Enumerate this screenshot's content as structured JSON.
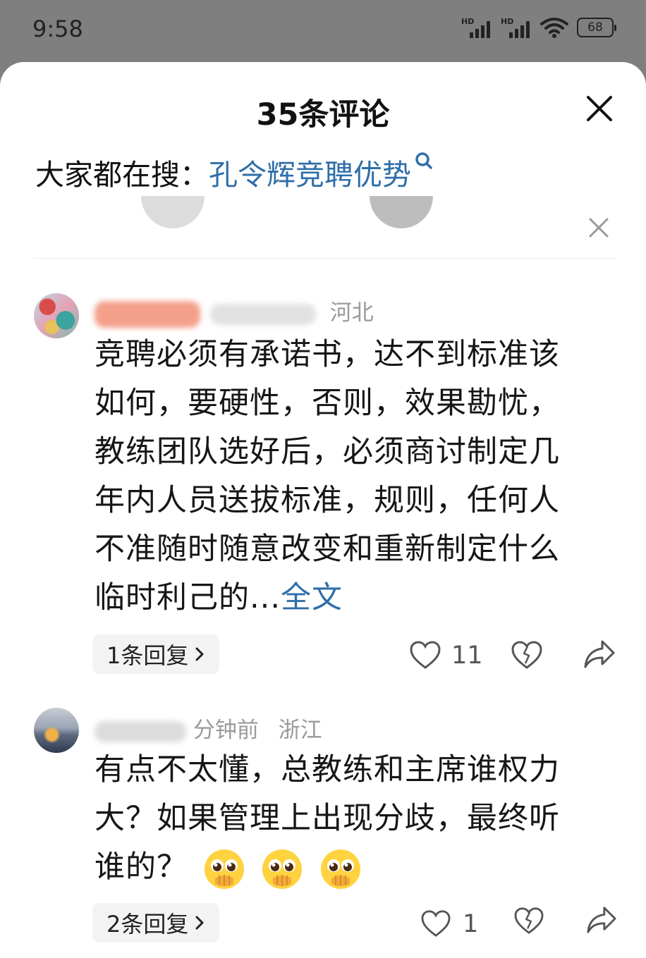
{
  "status_bar": {
    "time": "9:58",
    "signal_1_label": "HD",
    "signal_2_label": "HD",
    "battery": "68"
  },
  "sheet": {
    "title": "35条评论",
    "close_icon": "close-icon"
  },
  "hot_search": {
    "label": "大家都在搜：",
    "query": "孔令辉竞聘优势"
  },
  "comments": [
    {
      "username": "",
      "time": "",
      "location": "河北",
      "text_lines": [
        "竞聘必须有承诺书，达不到标准该",
        "如何，要硬性，否则，效果勘忧，",
        "教练团队选好后，必须商讨制定几",
        "年内人员送拔标准，规则，任何人",
        "不准随时随意改变和重新制定什么"
      ],
      "text_last": "临时利己的...",
      "full_text_link": "全文",
      "reply_label": "1条回复",
      "likes": "11"
    },
    {
      "username": "",
      "time": "分钟前",
      "location": "浙江",
      "text_lines": [
        "有点不太懂，总教练和主席谁权力",
        "大？如果管理上出现分歧，最终听"
      ],
      "text_last": "谁的？",
      "emoji_icon": "pleading-face-icon",
      "reply_label": "2条回复",
      "likes": "1"
    }
  ],
  "colors": {
    "link_blue": "#2f6ea8",
    "status_bar_bg": "#7f7f7f",
    "meta_gray": "#9a9a9a"
  }
}
